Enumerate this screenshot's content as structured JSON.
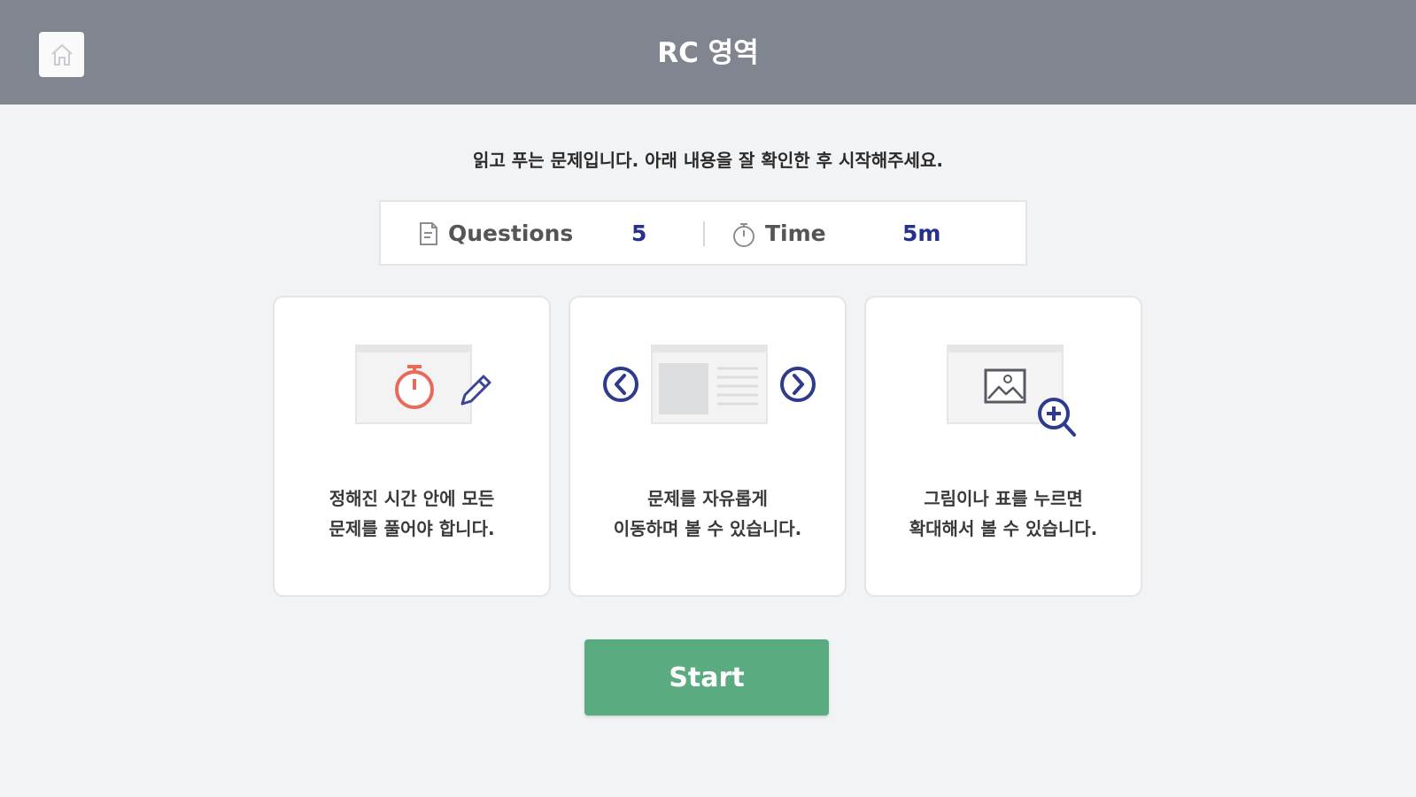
{
  "header": {
    "title": "RC 영역",
    "home_icon": "home-icon"
  },
  "intro_text": "읽고 푸는 문제입니다. 아래 내용을 잘 확인한 후 시작해주세요.",
  "info": {
    "questions_label": "Questions",
    "questions_value": "5",
    "time_label": "Time",
    "time_value": "5m",
    "questions_icon": "document-icon",
    "time_icon": "stopwatch-icon"
  },
  "cards": [
    {
      "text": "정해진 시간 안에 모든\n문제를 풀어야 합니다.",
      "icon": "stopwatch-pencil-illustration"
    },
    {
      "text": "문제를 자유롭게\n이동하며 볼 수 있습니다.",
      "icon": "page-navigation-illustration"
    },
    {
      "text": "그림이나 표를 누르면\n확대해서 볼 수 있습니다.",
      "icon": "image-zoom-illustration"
    }
  ],
  "start_label": "Start",
  "colors": {
    "header_bg": "#80858f",
    "accent_blue": "#25318c",
    "timer_red": "#e86a5a",
    "start_green": "#5aac80"
  }
}
